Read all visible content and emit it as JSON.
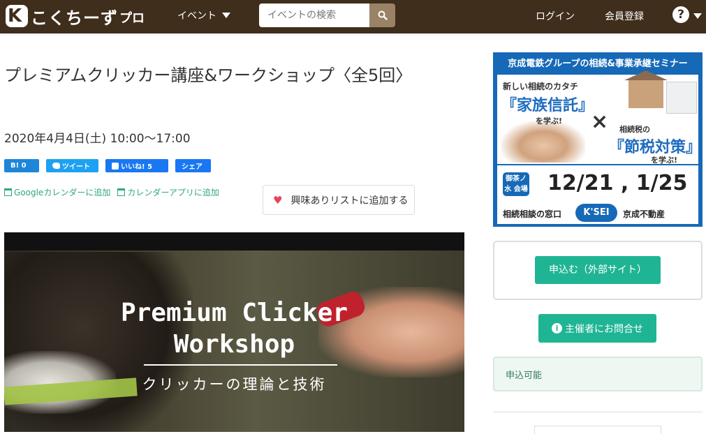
{
  "header": {
    "logo_text": "こくちーず",
    "logo_sub": "プロ",
    "nav_event": "イベント",
    "search_placeholder": "イベントの検索",
    "login": "ログイン",
    "signup": "会員登録",
    "help": "?"
  },
  "event": {
    "title": "プレミアムクリッカー講座&ワークショップ〈全5回〉",
    "date": "2020年4月4日(土) 10:00〜17:00"
  },
  "share": {
    "hatena": "B! 0",
    "tweet": "ツイート",
    "like": "いいね! 5",
    "share": "シェア"
  },
  "calendar": {
    "google": "Googleカレンダーに追加",
    "app": "カレンダーアプリに追加"
  },
  "favorite": {
    "label": "興味ありリストに追加する"
  },
  "hero": {
    "title_line1": "Premium Clicker",
    "title_line2": "Workshop",
    "subtitle": "クリッカーの理論と技術"
  },
  "ad": {
    "header": "京成電鉄グループの相続&事業承継セミナー",
    "left_l1": "新しい相続のカタチ",
    "left_l2": "『家族信託』",
    "left_l3": "を学ぶ!",
    "cross": "×",
    "right_l1": "相続税の",
    "right_l2": "『節税対策』",
    "right_l3": "を学ぶ!",
    "venue": "御茶ノ水 会場",
    "dates": "12/21 , 1/25",
    "window": "相続相談の窓口",
    "ksei": "K'SEI",
    "company": "京成不動産"
  },
  "sidebar": {
    "apply": "申込む（外部サイト）",
    "contact": "主催者にお問合せ",
    "status": "申込可能"
  },
  "colors": {
    "header_bg": "#3f2e1c",
    "accent_green": "#1fb594",
    "link_green": "#2fa77d",
    "ad_blue": "#1669b7"
  }
}
